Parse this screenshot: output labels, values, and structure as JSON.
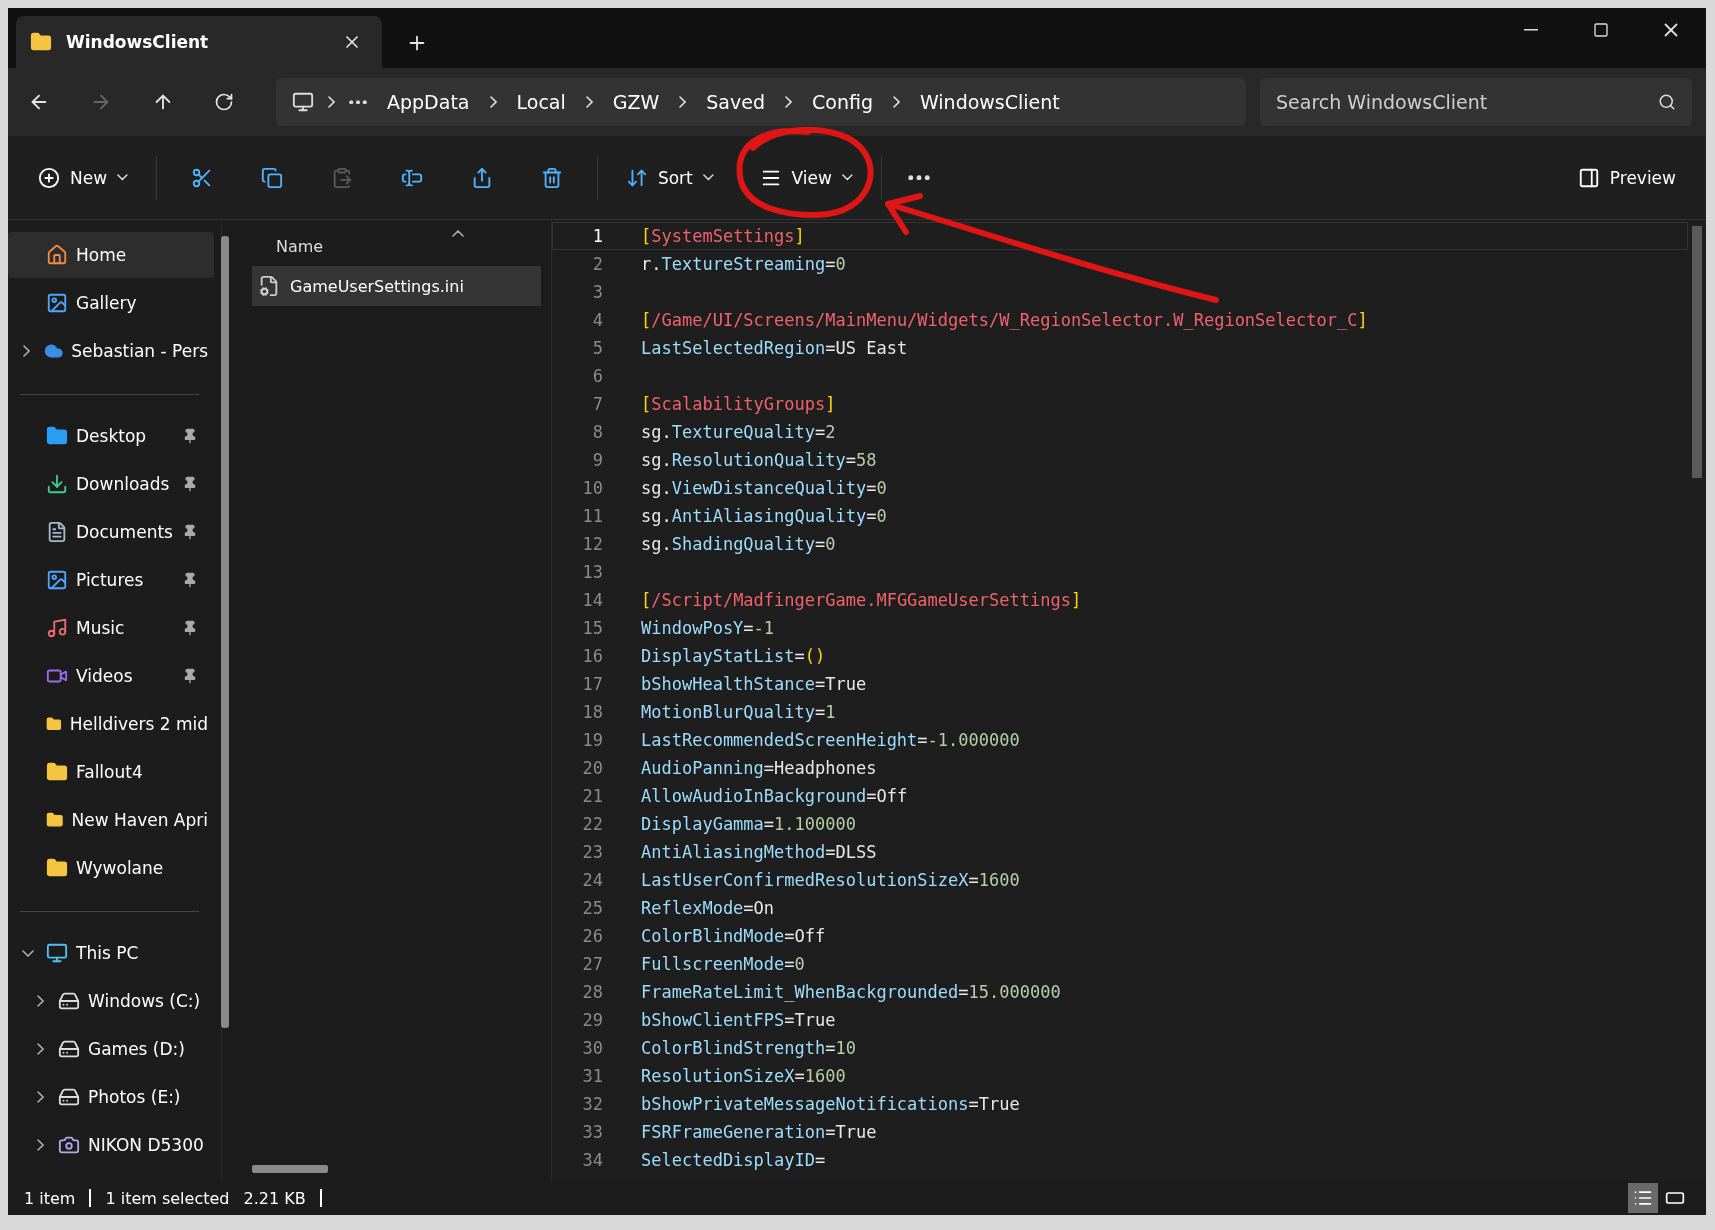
{
  "window": {
    "tab_title": "WindowsClient"
  },
  "breadcrumb": [
    "AppData",
    "Local",
    "GZW",
    "Saved",
    "Config",
    "WindowsClient"
  ],
  "search": {
    "placeholder": "Search WindowsClient"
  },
  "toolbar": {
    "new_label": "New",
    "icon_buttons": [
      {
        "disabled": false
      },
      {
        "disabled": false
      },
      {
        "disabled": true
      },
      {
        "disabled": false
      },
      {
        "disabled": false
      },
      {
        "disabled": false
      }
    ],
    "sort_label": "Sort",
    "view_label": "View",
    "preview_label": "Preview"
  },
  "sidebar": {
    "top_items": [
      {
        "label": "Home",
        "selected": true,
        "expandable": false
      },
      {
        "label": "Gallery",
        "selected": false,
        "expandable": false
      },
      {
        "label": "Sebastian - Pers",
        "selected": false,
        "expandable": true
      }
    ],
    "quick_access": [
      {
        "label": "Desktop",
        "pinned": true
      },
      {
        "label": "Downloads",
        "pinned": true
      },
      {
        "label": "Documents",
        "pinned": true
      },
      {
        "label": "Pictures",
        "pinned": true
      },
      {
        "label": "Music",
        "pinned": true
      },
      {
        "label": "Videos",
        "pinned": true
      },
      {
        "label": "Helldivers 2 mid",
        "pinned": false
      },
      {
        "label": "Fallout4",
        "pinned": false
      },
      {
        "label": "New Haven Apri",
        "pinned": false
      },
      {
        "label": "Wywolane",
        "pinned": false
      }
    ],
    "this_pc": {
      "label": "This PC",
      "expanded": true,
      "children": [
        {
          "label": "Windows (C:)",
          "expanded": false
        },
        {
          "label": "Games (D:)",
          "expanded": false
        },
        {
          "label": "Photos (E:)",
          "expanded": false
        },
        {
          "label": "NIKON D5300",
          "expanded": false
        }
      ]
    }
  },
  "file_list": {
    "column": "Name",
    "files": [
      {
        "name": "GameUserSettings.ini",
        "selected": true
      }
    ]
  },
  "preview": {
    "lines": [
      {
        "number": "1",
        "current": true,
        "segments": [
          {
            "kind": "punct",
            "text": "["
          },
          {
            "kind": "section",
            "text": "SystemSettings"
          },
          {
            "kind": "punct",
            "text": "]"
          }
        ]
      },
      {
        "number": "2",
        "current": false,
        "segments": [
          {
            "kind": "text",
            "text": "r."
          },
          {
            "kind": "key",
            "text": "TextureStreaming"
          },
          {
            "kind": "text",
            "text": "="
          },
          {
            "kind": "number",
            "text": "0"
          }
        ]
      },
      {
        "number": "3",
        "current": false
      },
      {
        "number": "4",
        "current": false,
        "segments": [
          {
            "kind": "punct",
            "text": "["
          },
          {
            "kind": "section",
            "text": "/Game/UI/Screens/MainMenu/Widgets/W_RegionSelector.W_RegionSelector_C"
          },
          {
            "kind": "punct",
            "text": "]"
          }
        ]
      },
      {
        "number": "5",
        "current": false,
        "segments": [
          {
            "kind": "key",
            "text": "LastSelectedRegion"
          },
          {
            "kind": "text",
            "text": "=US East"
          }
        ]
      },
      {
        "number": "6",
        "current": false
      },
      {
        "number": "7",
        "current": false,
        "segments": [
          {
            "kind": "punct",
            "text": "["
          },
          {
            "kind": "section",
            "text": "ScalabilityGroups"
          },
          {
            "kind": "punct",
            "text": "]"
          }
        ]
      },
      {
        "number": "8",
        "current": false,
        "segments": [
          {
            "kind": "text",
            "text": "sg."
          },
          {
            "kind": "key",
            "text": "TextureQuality"
          },
          {
            "kind": "text",
            "text": "="
          },
          {
            "kind": "number",
            "text": "2"
          }
        ]
      },
      {
        "number": "9",
        "current": false,
        "segments": [
          {
            "kind": "text",
            "text": "sg."
          },
          {
            "kind": "key",
            "text": "ResolutionQuality"
          },
          {
            "kind": "text",
            "text": "="
          },
          {
            "kind": "number",
            "text": "58"
          }
        ]
      },
      {
        "number": "10",
        "current": false,
        "segments": [
          {
            "kind": "text",
            "text": "sg."
          },
          {
            "kind": "key",
            "text": "ViewDistanceQuality"
          },
          {
            "kind": "text",
            "text": "="
          },
          {
            "kind": "number",
            "text": "0"
          }
        ]
      },
      {
        "number": "11",
        "current": false,
        "segments": [
          {
            "kind": "text",
            "text": "sg."
          },
          {
            "kind": "key",
            "text": "AntiAliasingQuality"
          },
          {
            "kind": "text",
            "text": "="
          },
          {
            "kind": "number",
            "text": "0"
          }
        ]
      },
      {
        "number": "12",
        "current": false,
        "segments": [
          {
            "kind": "text",
            "text": "sg."
          },
          {
            "kind": "key",
            "text": "ShadingQuality"
          },
          {
            "kind": "text",
            "text": "="
          },
          {
            "kind": "number",
            "text": "0"
          }
        ]
      },
      {
        "number": "13",
        "current": false
      },
      {
        "number": "14",
        "current": false,
        "segments": [
          {
            "kind": "punct",
            "text": "["
          },
          {
            "kind": "section",
            "text": "/Script/MadfingerGame.MFGGameUserSettings"
          },
          {
            "kind": "punct",
            "text": "]"
          }
        ]
      },
      {
        "number": "15",
        "current": false,
        "segments": [
          {
            "kind": "key",
            "text": "WindowPosY"
          },
          {
            "kind": "text",
            "text": "="
          },
          {
            "kind": "number",
            "text": "-1"
          }
        ]
      },
      {
        "number": "16",
        "current": false,
        "segments": [
          {
            "kind": "key",
            "text": "DisplayStatList"
          },
          {
            "kind": "text",
            "text": "="
          },
          {
            "kind": "punct",
            "text": "()"
          }
        ]
      },
      {
        "number": "17",
        "current": false,
        "segments": [
          {
            "kind": "key",
            "text": "bShowHealthStance"
          },
          {
            "kind": "text",
            "text": "=True"
          }
        ]
      },
      {
        "number": "18",
        "current": false,
        "segments": [
          {
            "kind": "key",
            "text": "MotionBlurQuality"
          },
          {
            "kind": "text",
            "text": "="
          },
          {
            "kind": "number",
            "text": "1"
          }
        ]
      },
      {
        "number": "19",
        "current": false,
        "segments": [
          {
            "kind": "key",
            "text": "LastRecommendedScreenHeight"
          },
          {
            "kind": "text",
            "text": "="
          },
          {
            "kind": "number",
            "text": "-1.000000"
          }
        ]
      },
      {
        "number": "20",
        "current": false,
        "segments": [
          {
            "kind": "key",
            "text": "AudioPanning"
          },
          {
            "kind": "text",
            "text": "=Headphones"
          }
        ]
      },
      {
        "number": "21",
        "current": false,
        "segments": [
          {
            "kind": "key",
            "text": "AllowAudioInBackground"
          },
          {
            "kind": "text",
            "text": "=Off"
          }
        ]
      },
      {
        "number": "22",
        "current": false,
        "segments": [
          {
            "kind": "key",
            "text": "DisplayGamma"
          },
          {
            "kind": "text",
            "text": "="
          },
          {
            "kind": "number",
            "text": "1.100000"
          }
        ]
      },
      {
        "number": "23",
        "current": false,
        "segments": [
          {
            "kind": "key",
            "text": "AntiAliasingMethod"
          },
          {
            "kind": "text",
            "text": "=DLSS"
          }
        ]
      },
      {
        "number": "24",
        "current": false,
        "segments": [
          {
            "kind": "key",
            "text": "LastUserConfirmedResolutionSizeX"
          },
          {
            "kind": "text",
            "text": "="
          },
          {
            "kind": "number",
            "text": "1600"
          }
        ]
      },
      {
        "number": "25",
        "current": false,
        "segments": [
          {
            "kind": "key",
            "text": "ReflexMode"
          },
          {
            "kind": "text",
            "text": "=On"
          }
        ]
      },
      {
        "number": "26",
        "current": false,
        "segments": [
          {
            "kind": "key",
            "text": "ColorBlindMode"
          },
          {
            "kind": "text",
            "text": "=Off"
          }
        ]
      },
      {
        "number": "27",
        "current": false,
        "segments": [
          {
            "kind": "key",
            "text": "FullscreenMode"
          },
          {
            "kind": "text",
            "text": "="
          },
          {
            "kind": "number",
            "text": "0"
          }
        ]
      },
      {
        "number": "28",
        "current": false,
        "segments": [
          {
            "kind": "key",
            "text": "FrameRateLimit_WhenBackgrounded"
          },
          {
            "kind": "text",
            "text": "="
          },
          {
            "kind": "number",
            "text": "15.000000"
          }
        ]
      },
      {
        "number": "29",
        "current": false,
        "segments": [
          {
            "kind": "key",
            "text": "bShowClientFPS"
          },
          {
            "kind": "text",
            "text": "=True"
          }
        ]
      },
      {
        "number": "30",
        "current": false,
        "segments": [
          {
            "kind": "key",
            "text": "ColorBlindStrength"
          },
          {
            "kind": "text",
            "text": "="
          },
          {
            "kind": "number",
            "text": "10"
          }
        ]
      },
      {
        "number": "31",
        "current": false,
        "segments": [
          {
            "kind": "key",
            "text": "ResolutionSizeX"
          },
          {
            "kind": "text",
            "text": "="
          },
          {
            "kind": "number",
            "text": "1600"
          }
        ]
      },
      {
        "number": "32",
        "current": false,
        "segments": [
          {
            "kind": "key",
            "text": "bShowPrivateMessageNotifications"
          },
          {
            "kind": "text",
            "text": "=True"
          }
        ]
      },
      {
        "number": "33",
        "current": false,
        "segments": [
          {
            "kind": "key",
            "text": "FSRFrameGeneration"
          },
          {
            "kind": "text",
            "text": "=True"
          }
        ]
      },
      {
        "number": "34",
        "current": false,
        "segments": [
          {
            "kind": "key",
            "text": "SelectedDisplayID"
          },
          {
            "kind": "text",
            "text": "="
          }
        ]
      }
    ]
  },
  "status_bar": {
    "item_count": "1 item",
    "selection": "1 item selected",
    "size": "2.21 KB",
    "views": [
      {
        "selected": true
      },
      {
        "selected": false
      }
    ]
  }
}
